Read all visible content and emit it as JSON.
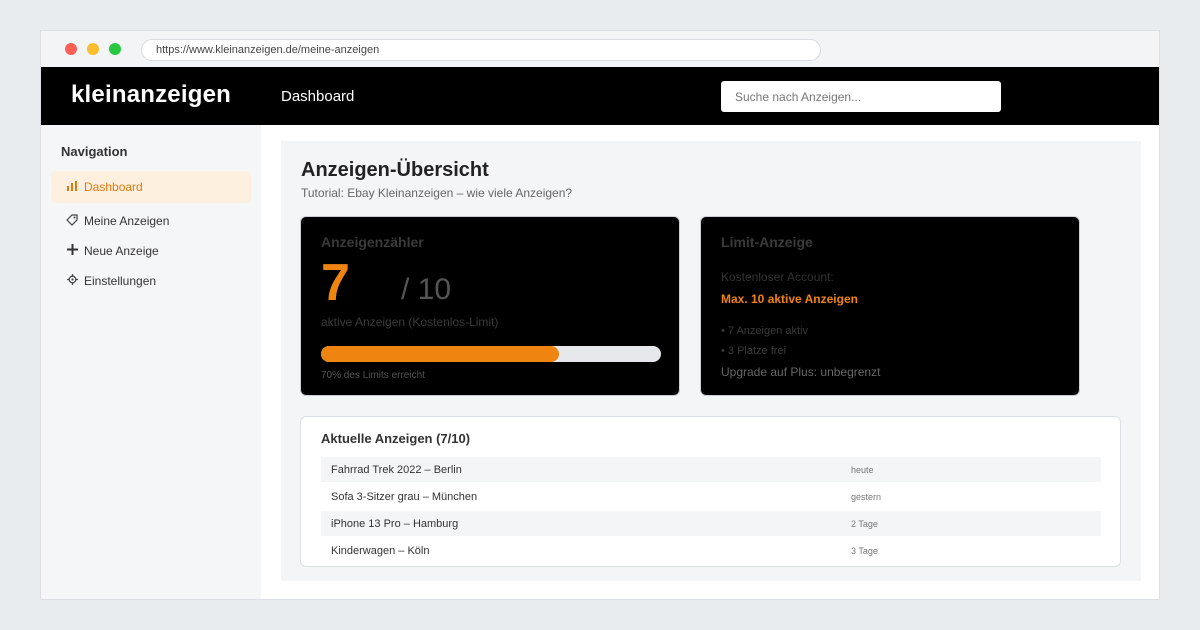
{
  "browser": {
    "url": "https://www.kleinanzeigen.de/meine-anzeigen"
  },
  "header": {
    "brand": "kleinanzeigen",
    "nav_label": "Dashboard",
    "search_placeholder": "Suche nach Anzeigen..."
  },
  "sidebar": {
    "title": "Navigation",
    "items": [
      {
        "icon": "bar-chart-icon",
        "glyph": "📊",
        "label": "Dashboard",
        "active": true
      },
      {
        "icon": "tag-icon",
        "glyph": "🏷",
        "label": "Meine Anzeigen",
        "active": false
      },
      {
        "icon": "plus-icon",
        "glyph": "➕",
        "label": "Neue Anzeige",
        "active": false
      },
      {
        "icon": "gear-icon",
        "glyph": "⚙",
        "label": "Einstellungen",
        "active": false
      }
    ]
  },
  "main": {
    "title": "Anzeigen-Übersicht",
    "subtitle": "Tutorial: Ebay Kleinanzeigen – wie viele Anzeigen?",
    "counter": {
      "heading": "Anzeigenzähler",
      "count": "7",
      "limit": "/ 10",
      "caption": "aktive Anzeigen (Kostenlos-Limit)",
      "progress_percent": 70,
      "progress_label": "70% des Limits erreicht"
    },
    "limit": {
      "heading": "Limit-Anzeige",
      "account": "Kostenloser Account:",
      "max": "Max. 10 aktive Anzeigen",
      "line1": "• 7 Anzeigen aktiv",
      "line2": "• 3 Plätze frei",
      "line3": "Upgrade auf Plus: unbegrenzt"
    },
    "listings": {
      "title": "Aktuelle Anzeigen (7/10)",
      "rows": [
        {
          "name": "Fahrrad Trek 2022 – Berlin",
          "when": "heute"
        },
        {
          "name": "Sofa 3-Sitzer grau – München",
          "when": "gestern"
        },
        {
          "name": "iPhone 13 Pro – Hamburg",
          "when": "2 Tage"
        },
        {
          "name": "Kinderwagen – Köln",
          "when": "3 Tage"
        }
      ]
    }
  },
  "colors": {
    "accent": "#f08410",
    "topbar": "#000000",
    "active_bg": "#fdf0df"
  }
}
